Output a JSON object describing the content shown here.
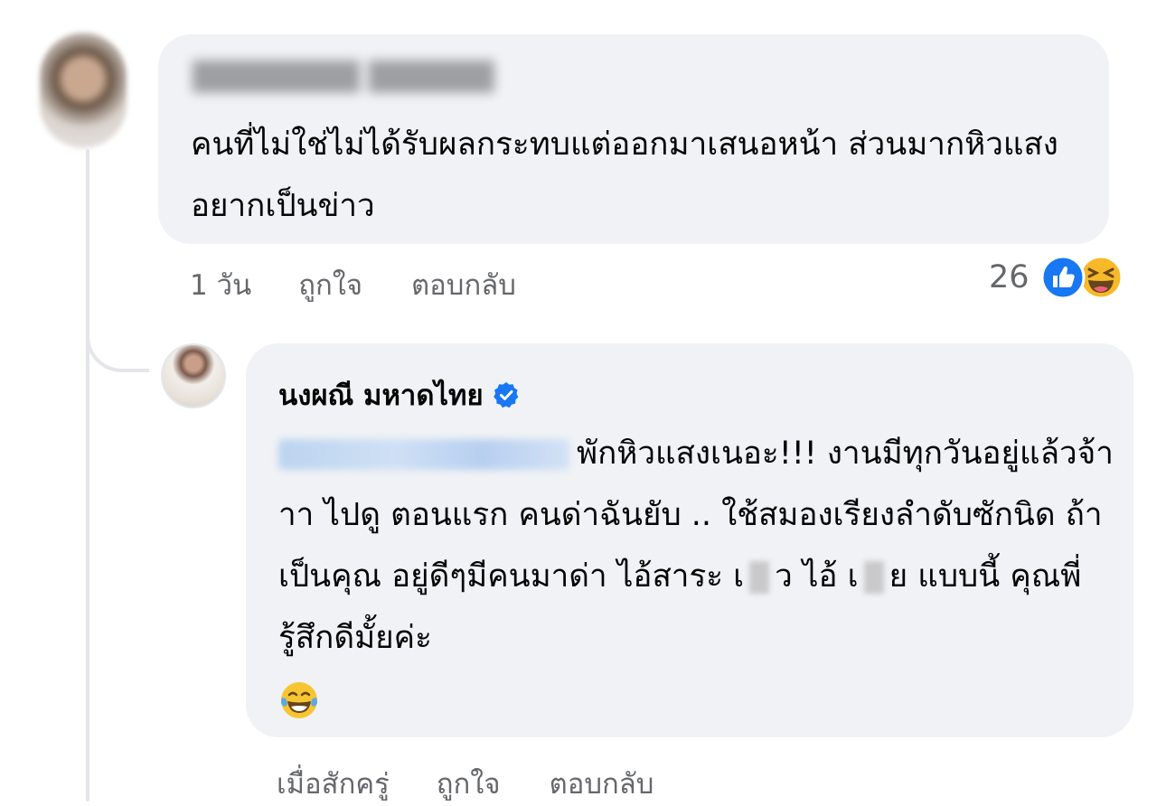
{
  "comment1": {
    "text": "คนที่ไม่ใช่ไม่ได้รับผลกระทบแต่ออกมาเสนอหน้า  ส่วนมากหิวแสงอยากเป็นข่าว",
    "time": "1 วัน",
    "like_label": "ถูกใจ",
    "reply_label": "ตอบกลับ",
    "reaction_count": "26",
    "reactions": [
      "like-icon",
      "haha-icon"
    ]
  },
  "reply": {
    "author": "นงผณี มหาดไทย",
    "verified": true,
    "text_part1": "พักหิวแสงเนอะ!!! งานมีทุกวันอยู่แล้วจ้าาา ไปดู ตอนแรก คนด่าฉันยับ .. ใช้สมองเรียงลำดับซักนิด ถ้าเป็นคุณ อยู่ดีๆมีคนมาด่า ไอ้สาระ เ",
    "text_part2": "ว ไอ้ เ",
    "text_part3": "ย แบบนี้ คุณพี่รู้สึกดีมั้ยค่ะ",
    "trailing_emoji": "tears-of-joy-emoji",
    "time": "เมื่อสักครู่",
    "like_label": "ถูกใจ",
    "reply_label": "ตอบกลับ"
  },
  "colors": {
    "bubble": "#f0f2f5",
    "secondary_text": "#65676b",
    "like_blue": "#1877f2",
    "haha_yellow": "#f7b928"
  }
}
